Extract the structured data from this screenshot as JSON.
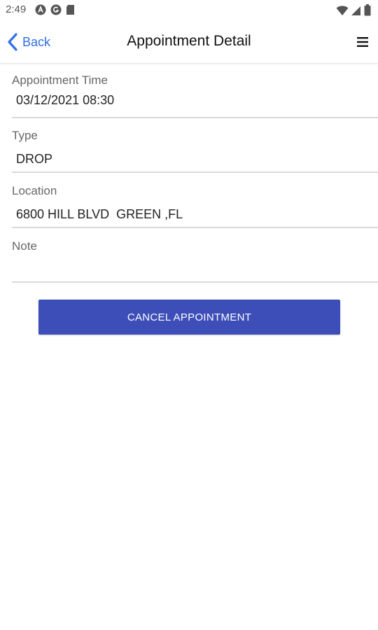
{
  "status_bar": {
    "time": "2:49",
    "left_icons": [
      "a-badge-icon",
      "g-badge-icon",
      "sd-card-icon"
    ],
    "right_icons": [
      "wifi-icon",
      "signal-icon",
      "battery-icon"
    ]
  },
  "nav": {
    "back_label": "Back",
    "title": "Appointment Detail",
    "accent_color": "#2f6fe6"
  },
  "fields": {
    "time": {
      "label": "Appointment Time",
      "value": "03/12/2021 08:30"
    },
    "type": {
      "label": "Type",
      "value": "DROP"
    },
    "location": {
      "label": "Location",
      "value": "6800 HILL BLVD  GREEN ,FL"
    },
    "note": {
      "label": "Note",
      "value": ""
    }
  },
  "actions": {
    "cancel_label": "CANCEL APPOINTMENT",
    "cancel_color": "#3d4eb8"
  }
}
